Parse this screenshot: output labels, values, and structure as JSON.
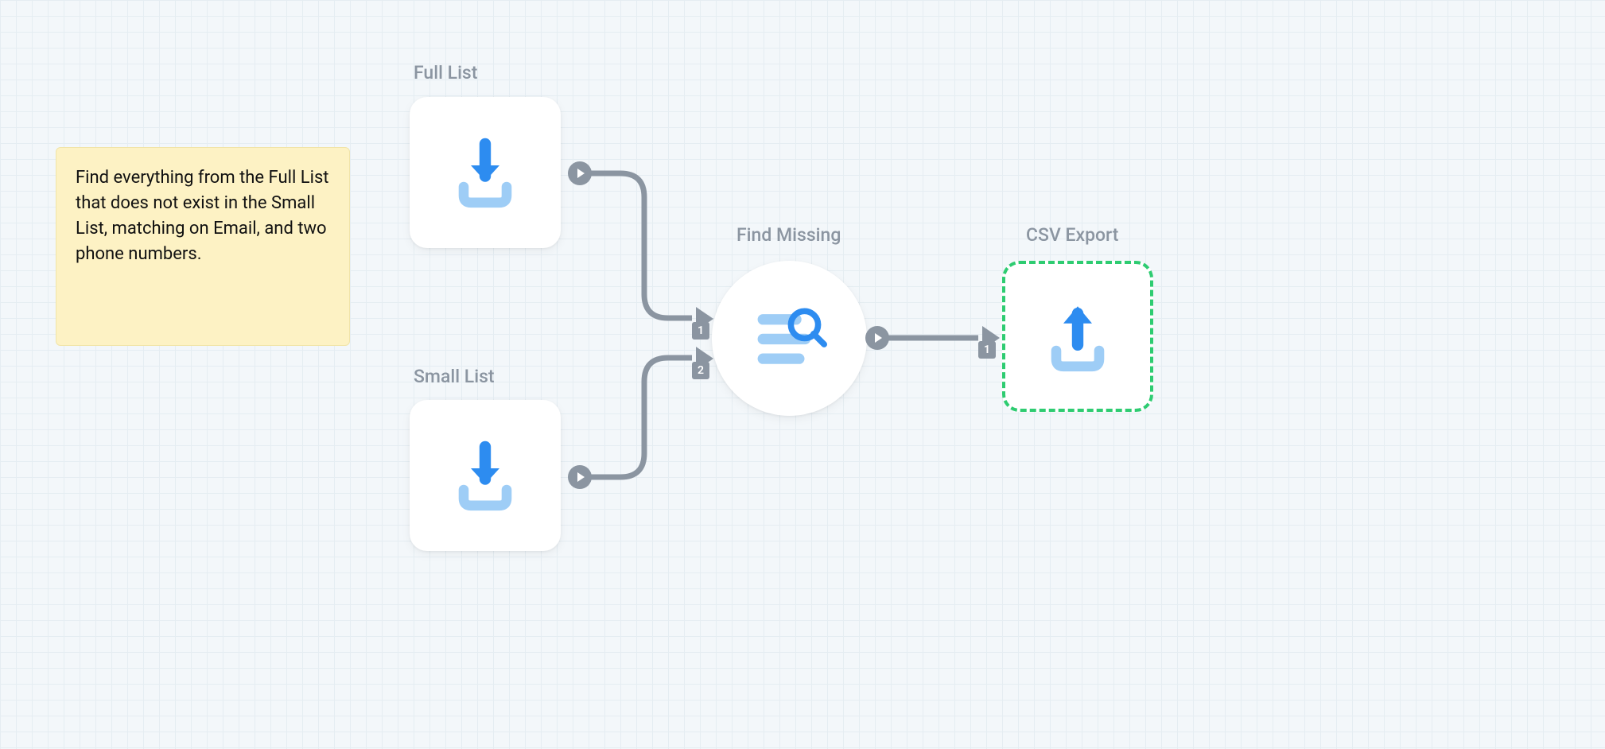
{
  "note": {
    "text": "Find everything from the Full List that does not exist in the Small List, matching on Email, and two phone numbers."
  },
  "nodes": {
    "full_list": {
      "label": "Full List"
    },
    "small_list": {
      "label": "Small List"
    },
    "find_missing": {
      "label": "Find Missing"
    },
    "csv_export": {
      "label": "CSV Export"
    }
  },
  "ports": {
    "find_missing_in1": "1",
    "find_missing_in2": "2",
    "csv_export_in1": "1"
  }
}
